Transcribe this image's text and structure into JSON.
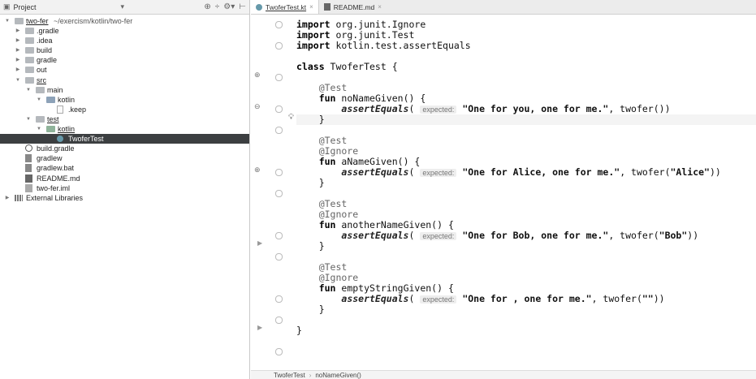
{
  "project_panel": {
    "title": "Project",
    "chevron": "▾",
    "tools": [
      "⊕",
      "÷",
      "⚙▾",
      "⊢"
    ]
  },
  "tree": [
    {
      "label": "two-fer",
      "path": " ~/exercism/kotlin/two-fer",
      "depth": 0,
      "arrow": "▼",
      "icon": "folder-icon",
      "name": "tree-item-two-fer",
      "underline": true
    },
    {
      "label": ".gradle",
      "depth": 1,
      "arrow": "▶",
      "icon": "folder-icon",
      "name": "tree-item-gradle-hidden"
    },
    {
      "label": ".idea",
      "depth": 1,
      "arrow": "▶",
      "icon": "folder-icon",
      "name": "tree-item-idea"
    },
    {
      "label": "build",
      "depth": 1,
      "arrow": "▶",
      "icon": "folder-icon",
      "name": "tree-item-build"
    },
    {
      "label": "gradle",
      "depth": 1,
      "arrow": "▶",
      "icon": "folder-icon",
      "name": "tree-item-gradle"
    },
    {
      "label": "out",
      "depth": 1,
      "arrow": "▶",
      "icon": "folder-icon",
      "name": "tree-item-out"
    },
    {
      "label": "src",
      "depth": 1,
      "arrow": "▼",
      "icon": "folder-icon",
      "name": "tree-item-src",
      "underline": true
    },
    {
      "label": "main",
      "depth": 2,
      "arrow": "▼",
      "icon": "folder-icon",
      "name": "tree-item-main"
    },
    {
      "label": "kotlin",
      "depth": 3,
      "arrow": "▼",
      "icon": "folder-icon blue",
      "name": "tree-item-main-kotlin"
    },
    {
      "label": ".keep",
      "depth": 4,
      "arrow": "",
      "icon": "file-icon",
      "name": "tree-item-keep"
    },
    {
      "label": "test",
      "depth": 2,
      "arrow": "▼",
      "icon": "folder-icon",
      "name": "tree-item-test",
      "underline": true
    },
    {
      "label": "kotlin",
      "depth": 3,
      "arrow": "▼",
      "icon": "folder-icon green",
      "name": "tree-item-test-kotlin",
      "underline": true
    },
    {
      "label": "TwoferTest",
      "depth": 4,
      "arrow": "",
      "icon": "kt-icon",
      "name": "tree-item-twofertest",
      "selected": true
    },
    {
      "label": "build.gradle",
      "depth": 1,
      "arrow": "",
      "icon": "gradle-icon",
      "name": "tree-item-build-gradle"
    },
    {
      "label": "gradlew",
      "depth": 1,
      "arrow": "",
      "icon": "shell-icon",
      "name": "tree-item-gradlew"
    },
    {
      "label": "gradlew.bat",
      "depth": 1,
      "arrow": "",
      "icon": "shell-icon",
      "name": "tree-item-gradlew-bat"
    },
    {
      "label": "README.md",
      "depth": 1,
      "arrow": "",
      "icon": "md-icon",
      "name": "tree-item-readme"
    },
    {
      "label": "two-fer.iml",
      "depth": 1,
      "arrow": "",
      "icon": "iml-icon",
      "name": "tree-item-iml"
    },
    {
      "label": "External Libraries",
      "depth": 0,
      "arrow": "▶",
      "icon": "libs-icon",
      "name": "tree-item-external-libraries"
    }
  ],
  "tabs": [
    {
      "label": "TwoferTest.kt",
      "active": true,
      "icon": "kotlin-file-icon",
      "close": "×"
    },
    {
      "label": "README.md",
      "active": false,
      "icon": "markdown-file-icon",
      "close": "×"
    }
  ],
  "code_lines": [
    [
      {
        "t": "import",
        "c": "kw"
      },
      {
        "t": " org.junit.Ignore"
      }
    ],
    [
      {
        "t": "import",
        "c": "kw"
      },
      {
        "t": " org.junit.Test"
      }
    ],
    [
      {
        "t": "import",
        "c": "kw"
      },
      {
        "t": " kotlin.test.assertEquals"
      }
    ],
    [],
    [
      {
        "t": "class",
        "c": "kw"
      },
      {
        "t": " TwoferTest {"
      }
    ],
    [],
    [
      {
        "t": "    @Test",
        "c": "ann"
      }
    ],
    [
      {
        "t": "    "
      },
      {
        "t": "fun",
        "c": "kw"
      },
      {
        "t": " noNameGiven() {"
      }
    ],
    [
      {
        "t": "        "
      },
      {
        "t": "assertEquals",
        "c": "fn-call"
      },
      {
        "t": "( "
      },
      {
        "t": "expected:",
        "c": "hint"
      },
      {
        "t": " "
      },
      {
        "t": "\"One for you, one for me.\"",
        "c": "str"
      },
      {
        "t": ", twofer())"
      }
    ],
    [
      {
        "t": "    }"
      }
    ],
    [],
    [
      {
        "t": "    @Test",
        "c": "ann"
      }
    ],
    [
      {
        "t": "    @Ignore",
        "c": "ann"
      }
    ],
    [
      {
        "t": "    "
      },
      {
        "t": "fun",
        "c": "kw"
      },
      {
        "t": " aNameGiven() {"
      }
    ],
    [
      {
        "t": "        "
      },
      {
        "t": "assertEquals",
        "c": "fn-call"
      },
      {
        "t": "( "
      },
      {
        "t": "expected:",
        "c": "hint"
      },
      {
        "t": " "
      },
      {
        "t": "\"One for Alice, one for me.\"",
        "c": "str"
      },
      {
        "t": ", twofer("
      },
      {
        "t": "\"Alice\"",
        "c": "str"
      },
      {
        "t": "))"
      }
    ],
    [
      {
        "t": "    }"
      }
    ],
    [],
    [
      {
        "t": "    @Test",
        "c": "ann"
      }
    ],
    [
      {
        "t": "    @Ignore",
        "c": "ann"
      }
    ],
    [
      {
        "t": "    "
      },
      {
        "t": "fun",
        "c": "kw"
      },
      {
        "t": " anotherNameGiven() {"
      }
    ],
    [
      {
        "t": "        "
      },
      {
        "t": "assertEquals",
        "c": "fn-call"
      },
      {
        "t": "( "
      },
      {
        "t": "expected:",
        "c": "hint"
      },
      {
        "t": " "
      },
      {
        "t": "\"One for Bob, one for me.\"",
        "c": "str"
      },
      {
        "t": ", twofer("
      },
      {
        "t": "\"Bob\"",
        "c": "str"
      },
      {
        "t": "))"
      }
    ],
    [
      {
        "t": "    }"
      }
    ],
    [],
    [
      {
        "t": "    @Test",
        "c": "ann"
      }
    ],
    [
      {
        "t": "    @Ignore",
        "c": "ann"
      }
    ],
    [
      {
        "t": "    "
      },
      {
        "t": "fun",
        "c": "kw"
      },
      {
        "t": " emptyStringGiven() {"
      }
    ],
    [
      {
        "t": "        "
      },
      {
        "t": "assertEquals",
        "c": "fn-call"
      },
      {
        "t": "( "
      },
      {
        "t": "expected:",
        "c": "hint"
      },
      {
        "t": " "
      },
      {
        "t": "\"One for , one for me.\"",
        "c": "str"
      },
      {
        "t": ", twofer("
      },
      {
        "t": "\"\"",
        "c": "str"
      },
      {
        "t": "))"
      }
    ],
    [
      {
        "t": "    }"
      }
    ],
    [],
    [
      {
        "t": "}"
      }
    ]
  ],
  "breadcrumb": {
    "items": [
      "TwoferTest",
      "noNameGiven()"
    ],
    "separator": "›"
  }
}
